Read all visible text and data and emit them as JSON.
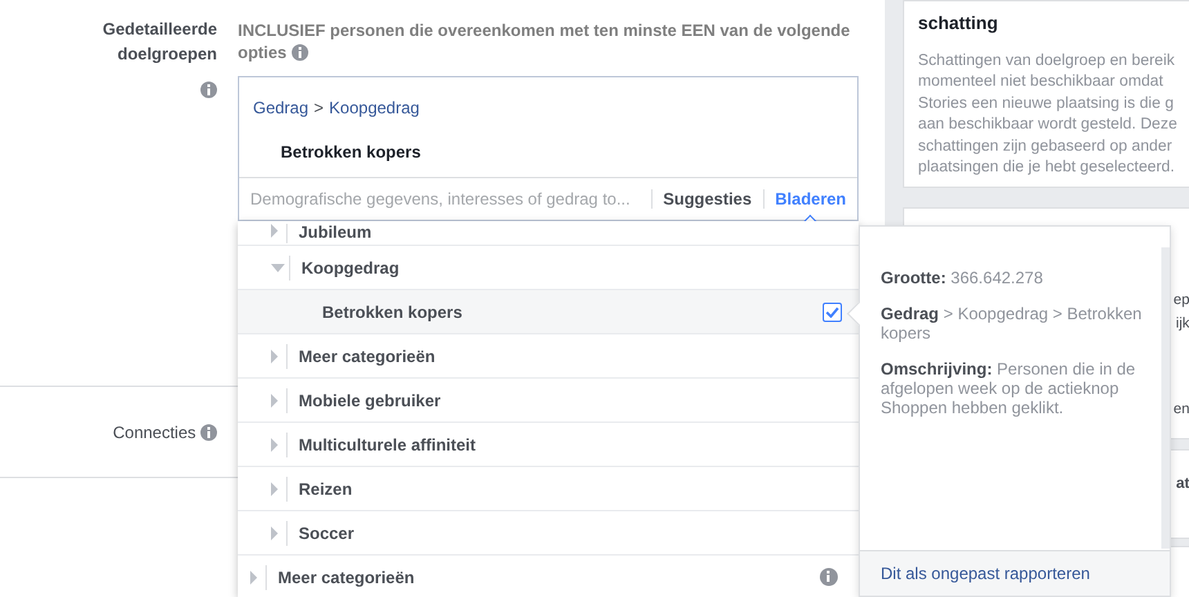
{
  "detailed_targeting": {
    "label": "Gedetailleerde doelgroepen",
    "heading_lines": [
      "INCLUSIEF personen die overeenkomen met ten minste EEN van de volgende",
      "opties"
    ],
    "breadcrumb": {
      "items": [
        "Gedrag",
        "Koopgedrag"
      ],
      "separator": ">"
    },
    "selected_item": "Betrokken kopers",
    "search": {
      "placeholder": "Demografische gegevens, interesses of gedrag to..."
    },
    "tabs": [
      {
        "label": "Suggesties",
        "selected": false
      },
      {
        "label": "Bladeren",
        "selected": true
      }
    ]
  },
  "connections": {
    "label": "Connecties"
  },
  "browse_dropdown": {
    "scrolled_children": [
      {
        "label": "Jubileum",
        "expanded": false
      },
      {
        "label": "Koopgedrag",
        "expanded": true,
        "children": [
          {
            "label": "Betrokken kopers",
            "checked": true,
            "selected": true
          }
        ]
      },
      {
        "label": "Meer categorieën",
        "expanded": false
      },
      {
        "label": "Mobiele gebruiker",
        "expanded": false
      },
      {
        "label": "Multiculturele affiniteit",
        "expanded": false
      },
      {
        "label": "Reizen",
        "expanded": false
      },
      {
        "label": "Soccer",
        "expanded": false
      }
    ],
    "root_items": [
      {
        "label": "Meer categorieën",
        "expanded": false
      }
    ]
  },
  "detail_tooltip": {
    "lines": [
      "**Grootte:** 366.642.278",
      "**Gedrag** > Koopgedrag > Betrokken kopers",
      "**Omschrijving:** Personen die in de afgelopen week op de actieknop Shoppen hebben geklikt."
    ],
    "report_link": "Dit als ongepast rapporteren"
  },
  "side_panel": {
    "cards": [
      {
        "title": "schatting",
        "lines": [
          "Schattingen van doelgroep en bereik",
          "momenteel niet beschikbaar omdat",
          "Stories een nieuwe plaatsing is die g",
          "aan beschikbaar wordt gesteld. Deze",
          "schattingen zijn gebaseerd op ander",
          "plaatsingen die je hebt geselecteerd."
        ]
      },
      {
        "fragments": [
          {
            "text": "ep",
            "kind": "text"
          },
          {
            "text": "ijk",
            "kind": "text"
          },
          {
            "text": "en",
            "kind": "text"
          }
        ]
      },
      {
        "fragments": [
          {
            "text": "at",
            "kind": "heading"
          }
        ]
      }
    ]
  }
}
